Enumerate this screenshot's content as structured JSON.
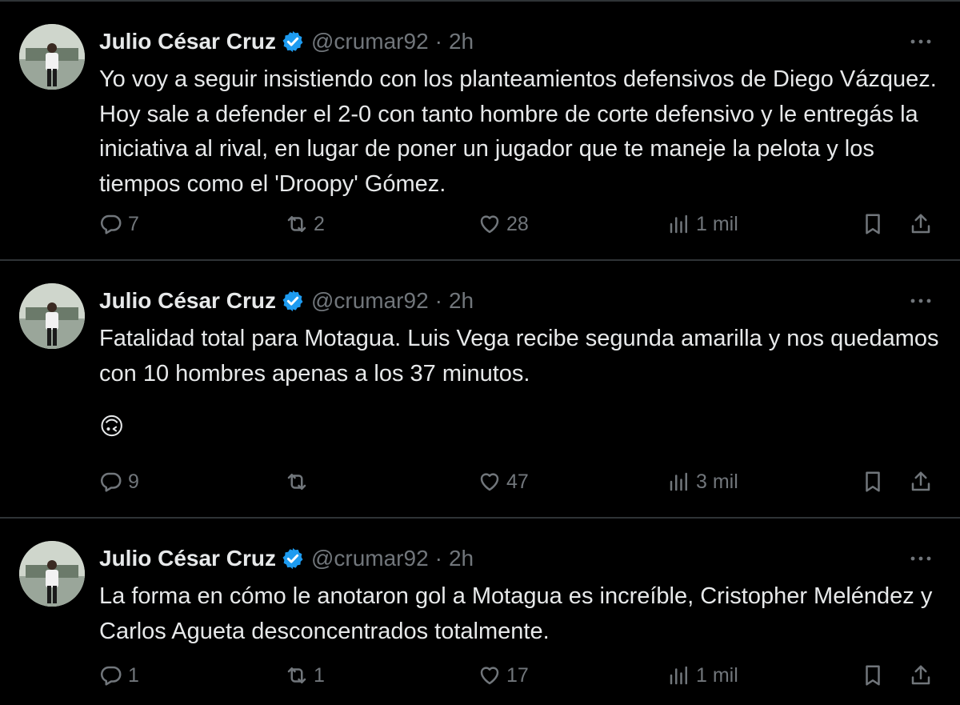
{
  "tweets": [
    {
      "author": "Julio César Cruz",
      "handle": "@crumar92",
      "time": "2h",
      "text": "Yo voy a seguir insistiendo con los planteamientos defensivos de Diego Vázquez. Hoy sale a defender el 2-0 con tanto hombre de corte defensivo y le entregás la iniciativa al rival, en lugar de poner un jugador que te maneje la pelota y los tiempos como el 'Droopy' Gómez.",
      "emoji": "",
      "replies": "7",
      "reposts": "2",
      "likes": "28",
      "views": "1 mil"
    },
    {
      "author": "Julio César Cruz",
      "handle": "@crumar92",
      "time": "2h",
      "text": "Fatalidad total para Motagua. Luis Vega recibe segunda amarilla y nos quedamos con 10 hombres apenas a los 37 minutos.",
      "emoji": "🙃",
      "replies": "9",
      "reposts": "",
      "likes": "47",
      "views": "3 mil"
    },
    {
      "author": "Julio César Cruz",
      "handle": "@crumar92",
      "time": "2h",
      "text": "La forma en cómo le anotaron gol a Motagua es increíble, Cristopher Meléndez y Carlos Agueta desconcentrados totalmente.",
      "emoji": "",
      "replies": "1",
      "reposts": "1",
      "likes": "17",
      "views": "1 mil"
    }
  ],
  "colors": {
    "background": "#000000",
    "text": "#e7e9ea",
    "muted": "#71767b",
    "divider": "#2f3336",
    "verified": "#1d9bf0"
  },
  "icons": [
    "avatar",
    "verified-badge-icon",
    "more-icon",
    "reply-icon",
    "repost-icon",
    "like-icon",
    "views-icon",
    "bookmark-icon",
    "share-icon"
  ]
}
